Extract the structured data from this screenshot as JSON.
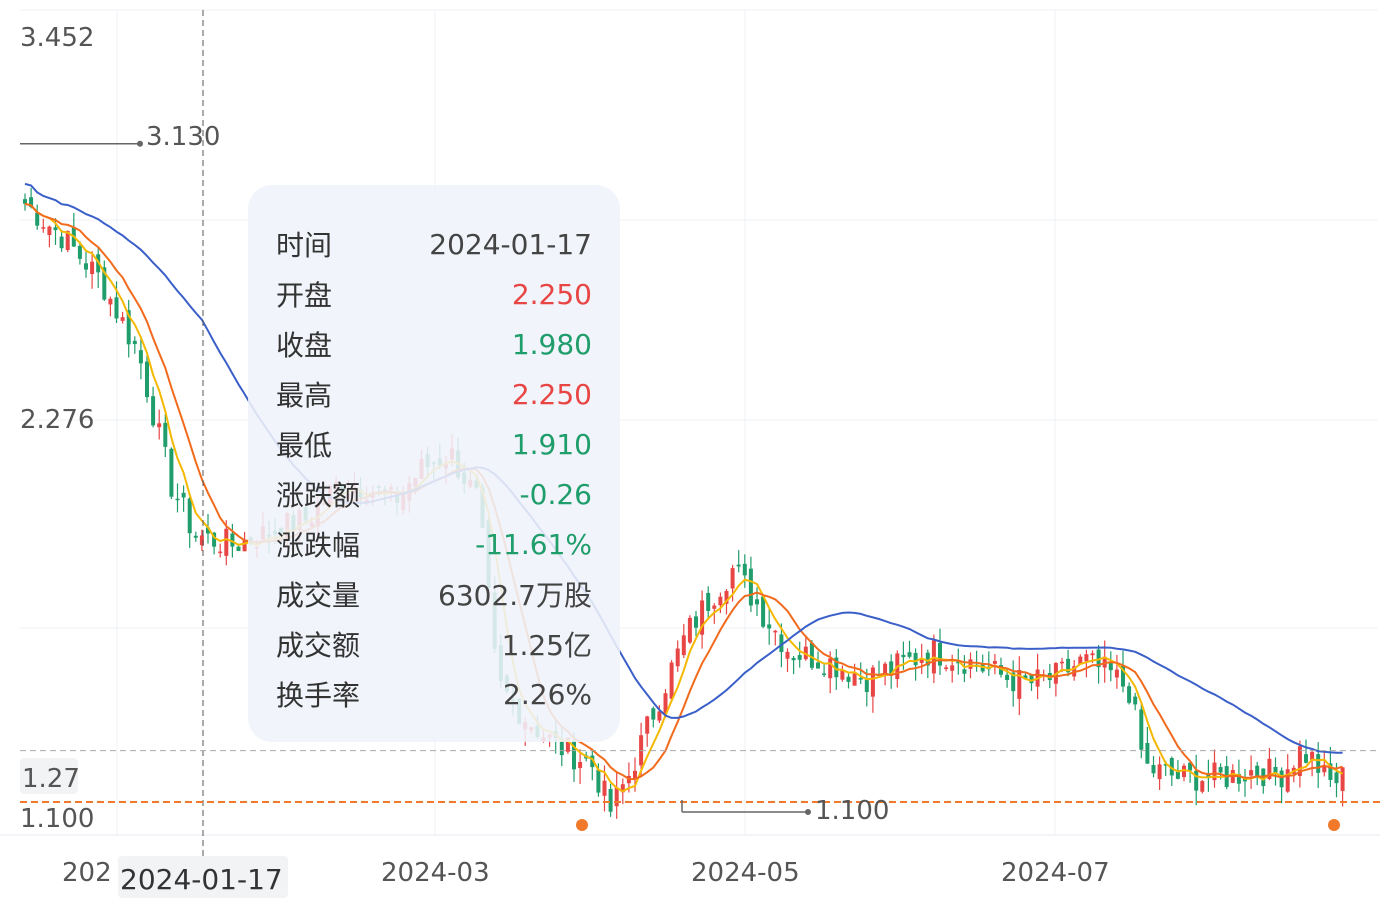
{
  "chart_data": {
    "type": "candlestick",
    "y_axis_labels": [
      "3.452",
      "2.276",
      "1.27",
      "1.100"
    ],
    "x_axis_labels": [
      "2024-03",
      "2024-05",
      "2024-07"
    ],
    "x_axis_first_label": "202",
    "ylim": [
      1.1,
      3.452
    ],
    "grid": true,
    "crosshair": {
      "date_label": "2024-01-17"
    },
    "current_price_line": "1.27",
    "low_line": "1.100",
    "annotations": {
      "max": {
        "label": "3.130",
        "value": 3.13
      },
      "min": {
        "label": "1.100",
        "value": 1.1
      }
    },
    "series": [
      {
        "key": "MA5",
        "color": "#f5b800"
      },
      {
        "key": "MA10",
        "color": "#f26b1d"
      },
      {
        "key": "MA30",
        "color": "#3b5fc9"
      }
    ],
    "colors": {
      "up": "#e84545",
      "down": "#1f9d6b",
      "price_line": "#f07a2a"
    },
    "tooltip": [
      {
        "label": "时间",
        "value": "2024-01-17",
        "tone": ""
      },
      {
        "label": "开盘",
        "value": "2.250",
        "tone": "up"
      },
      {
        "label": "收盘",
        "value": "1.980",
        "tone": "down"
      },
      {
        "label": "最高",
        "value": "2.250",
        "tone": "up"
      },
      {
        "label": "最低",
        "value": "1.910",
        "tone": "down"
      },
      {
        "label": "涨跌额",
        "value": "-0.26",
        "tone": "down"
      },
      {
        "label": "涨跌幅",
        "value": "-11.61%",
        "tone": "down"
      },
      {
        "label": "成交量",
        "value": "6302.7万股",
        "tone": ""
      },
      {
        "label": "成交额",
        "value": "1.25亿",
        "tone": ""
      },
      {
        "label": "换手率",
        "value": "2.26%",
        "tone": ""
      }
    ]
  }
}
